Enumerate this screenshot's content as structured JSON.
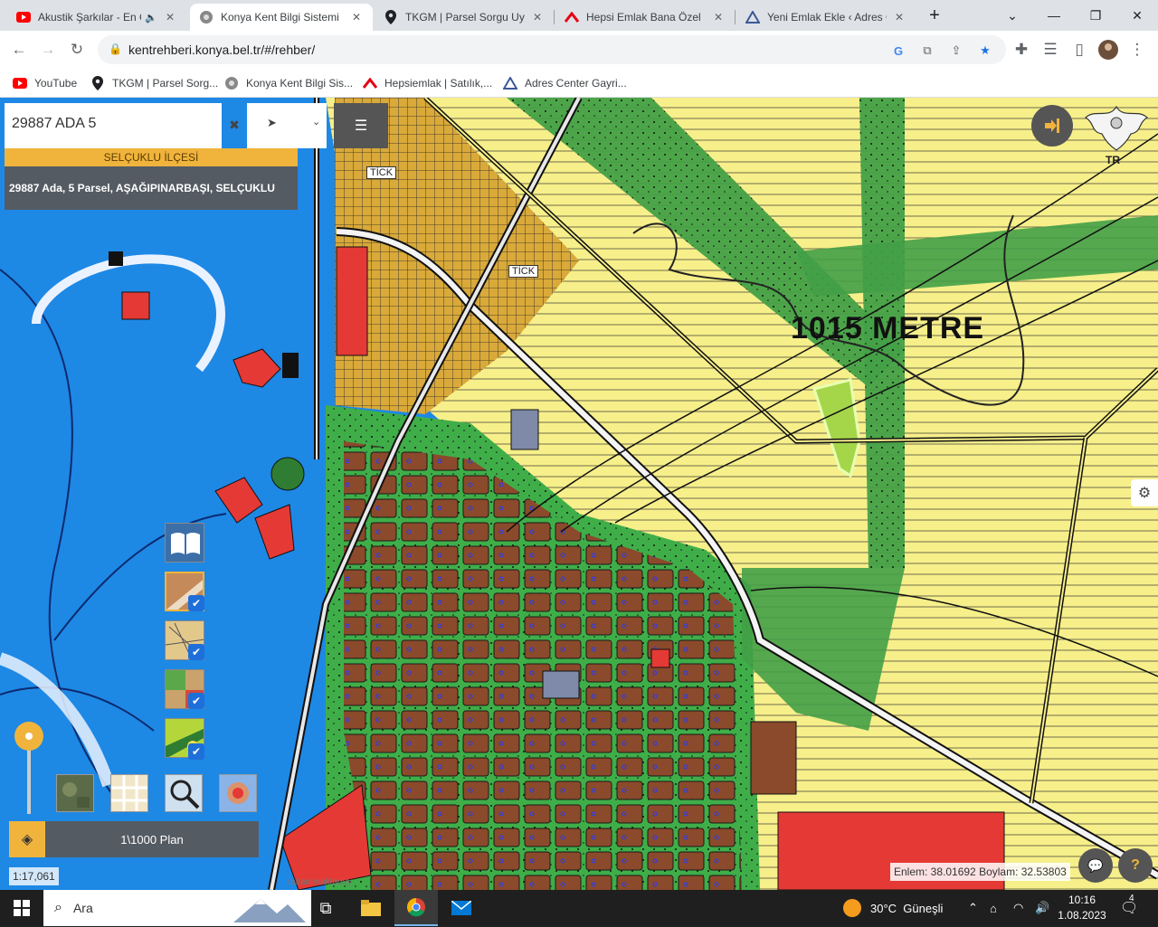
{
  "browser": {
    "tabs": [
      {
        "title": "Akustik Şarkılar - En Ç",
        "icon": "youtube-icon",
        "color": "#ff0000"
      },
      {
        "title": "Konya Kent Bilgi Sistemi",
        "icon": "kent-icon",
        "color": "#5f6368"
      },
      {
        "title": "TKGM | Parsel Sorgu Uygu",
        "icon": "map-pin-icon",
        "color": "#202124"
      },
      {
        "title": "Hepsi Emlak Bana Özel",
        "icon": "hepsiemlak-icon",
        "color": "#e60012"
      },
      {
        "title": "Yeni Emlak Ekle ‹ Adres Ce",
        "icon": "adres-icon",
        "color": "#3b5998"
      }
    ],
    "new_tab_label": "+",
    "url": "kentrehberi.konya.bel.tr/#/rehber/",
    "bookmarks": [
      {
        "label": "YouTube",
        "icon": "youtube-icon"
      },
      {
        "label": "TKGM | Parsel Sorg...",
        "icon": "map-pin-icon"
      },
      {
        "label": "Konya Kent Bilgi Sis...",
        "icon": "kent-icon"
      },
      {
        "label": "Hepsiemlak | Satılık,...",
        "icon": "hepsiemlak-icon"
      },
      {
        "label": "Adres Center Gayri...",
        "icon": "adres-icon"
      }
    ]
  },
  "map": {
    "search_value": "29887 ADA 5",
    "district": "SELÇUKLU İLÇESİ",
    "parcel_result": "29887 Ada, 5 Parsel, AŞAĞIPINARBAŞI, SELÇUKLU",
    "plan_label": "1\\1000 Plan",
    "scale": "1:17,061",
    "distance_label": "1015 METRE",
    "tick_labels": [
      "TİCK",
      "TİCK"
    ],
    "emblem_text": "TR",
    "coords_text": "Enlem: 38.01692 Boylam: 32.53803",
    "attribution": "raitammaktaduy",
    "colors": {
      "water": "#1e88e5",
      "residential_yellow": "#f7ef8a",
      "green": "#4caf50",
      "brown": "#8b4a2b",
      "red": "#e53935",
      "accent": "#f0b43c"
    }
  },
  "taskbar": {
    "search_placeholder": "Ara",
    "weather": "30°C  Güneşli",
    "time": "10:16",
    "date": "1.08.2023",
    "notif_count": "4"
  }
}
